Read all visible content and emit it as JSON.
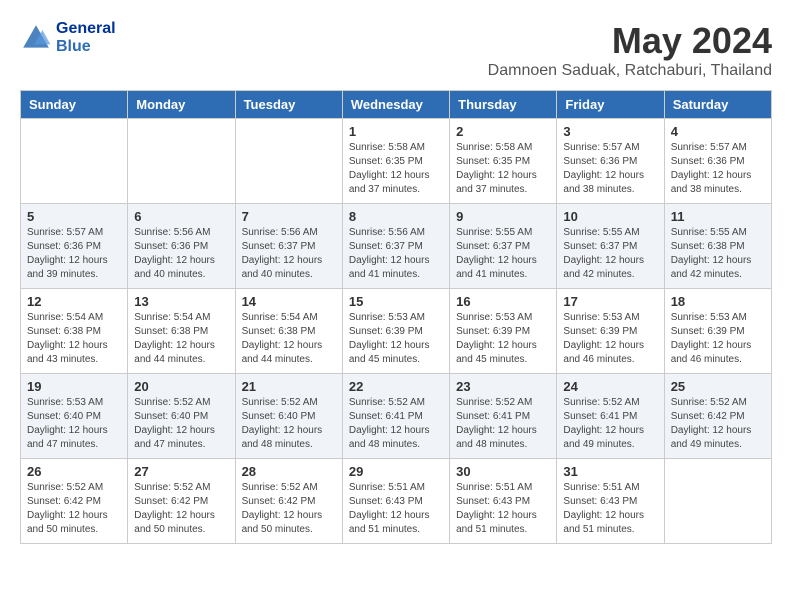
{
  "header": {
    "logo_line1": "General",
    "logo_line2": "Blue",
    "month": "May 2024",
    "location": "Damnoen Saduak, Ratchaburi, Thailand"
  },
  "days_of_week": [
    "Sunday",
    "Monday",
    "Tuesday",
    "Wednesday",
    "Thursday",
    "Friday",
    "Saturday"
  ],
  "weeks": [
    [
      {
        "day": "",
        "info": ""
      },
      {
        "day": "",
        "info": ""
      },
      {
        "day": "",
        "info": ""
      },
      {
        "day": "1",
        "info": "Sunrise: 5:58 AM\nSunset: 6:35 PM\nDaylight: 12 hours\nand 37 minutes."
      },
      {
        "day": "2",
        "info": "Sunrise: 5:58 AM\nSunset: 6:35 PM\nDaylight: 12 hours\nand 37 minutes."
      },
      {
        "day": "3",
        "info": "Sunrise: 5:57 AM\nSunset: 6:36 PM\nDaylight: 12 hours\nand 38 minutes."
      },
      {
        "day": "4",
        "info": "Sunrise: 5:57 AM\nSunset: 6:36 PM\nDaylight: 12 hours\nand 38 minutes."
      }
    ],
    [
      {
        "day": "5",
        "info": "Sunrise: 5:57 AM\nSunset: 6:36 PM\nDaylight: 12 hours\nand 39 minutes."
      },
      {
        "day": "6",
        "info": "Sunrise: 5:56 AM\nSunset: 6:36 PM\nDaylight: 12 hours\nand 40 minutes."
      },
      {
        "day": "7",
        "info": "Sunrise: 5:56 AM\nSunset: 6:37 PM\nDaylight: 12 hours\nand 40 minutes."
      },
      {
        "day": "8",
        "info": "Sunrise: 5:56 AM\nSunset: 6:37 PM\nDaylight: 12 hours\nand 41 minutes."
      },
      {
        "day": "9",
        "info": "Sunrise: 5:55 AM\nSunset: 6:37 PM\nDaylight: 12 hours\nand 41 minutes."
      },
      {
        "day": "10",
        "info": "Sunrise: 5:55 AM\nSunset: 6:37 PM\nDaylight: 12 hours\nand 42 minutes."
      },
      {
        "day": "11",
        "info": "Sunrise: 5:55 AM\nSunset: 6:38 PM\nDaylight: 12 hours\nand 42 minutes."
      }
    ],
    [
      {
        "day": "12",
        "info": "Sunrise: 5:54 AM\nSunset: 6:38 PM\nDaylight: 12 hours\nand 43 minutes."
      },
      {
        "day": "13",
        "info": "Sunrise: 5:54 AM\nSunset: 6:38 PM\nDaylight: 12 hours\nand 44 minutes."
      },
      {
        "day": "14",
        "info": "Sunrise: 5:54 AM\nSunset: 6:38 PM\nDaylight: 12 hours\nand 44 minutes."
      },
      {
        "day": "15",
        "info": "Sunrise: 5:53 AM\nSunset: 6:39 PM\nDaylight: 12 hours\nand 45 minutes."
      },
      {
        "day": "16",
        "info": "Sunrise: 5:53 AM\nSunset: 6:39 PM\nDaylight: 12 hours\nand 45 minutes."
      },
      {
        "day": "17",
        "info": "Sunrise: 5:53 AM\nSunset: 6:39 PM\nDaylight: 12 hours\nand 46 minutes."
      },
      {
        "day": "18",
        "info": "Sunrise: 5:53 AM\nSunset: 6:39 PM\nDaylight: 12 hours\nand 46 minutes."
      }
    ],
    [
      {
        "day": "19",
        "info": "Sunrise: 5:53 AM\nSunset: 6:40 PM\nDaylight: 12 hours\nand 47 minutes."
      },
      {
        "day": "20",
        "info": "Sunrise: 5:52 AM\nSunset: 6:40 PM\nDaylight: 12 hours\nand 47 minutes."
      },
      {
        "day": "21",
        "info": "Sunrise: 5:52 AM\nSunset: 6:40 PM\nDaylight: 12 hours\nand 48 minutes."
      },
      {
        "day": "22",
        "info": "Sunrise: 5:52 AM\nSunset: 6:41 PM\nDaylight: 12 hours\nand 48 minutes."
      },
      {
        "day": "23",
        "info": "Sunrise: 5:52 AM\nSunset: 6:41 PM\nDaylight: 12 hours\nand 48 minutes."
      },
      {
        "day": "24",
        "info": "Sunrise: 5:52 AM\nSunset: 6:41 PM\nDaylight: 12 hours\nand 49 minutes."
      },
      {
        "day": "25",
        "info": "Sunrise: 5:52 AM\nSunset: 6:42 PM\nDaylight: 12 hours\nand 49 minutes."
      }
    ],
    [
      {
        "day": "26",
        "info": "Sunrise: 5:52 AM\nSunset: 6:42 PM\nDaylight: 12 hours\nand 50 minutes."
      },
      {
        "day": "27",
        "info": "Sunrise: 5:52 AM\nSunset: 6:42 PM\nDaylight: 12 hours\nand 50 minutes."
      },
      {
        "day": "28",
        "info": "Sunrise: 5:52 AM\nSunset: 6:42 PM\nDaylight: 12 hours\nand 50 minutes."
      },
      {
        "day": "29",
        "info": "Sunrise: 5:51 AM\nSunset: 6:43 PM\nDaylight: 12 hours\nand 51 minutes."
      },
      {
        "day": "30",
        "info": "Sunrise: 5:51 AM\nSunset: 6:43 PM\nDaylight: 12 hours\nand 51 minutes."
      },
      {
        "day": "31",
        "info": "Sunrise: 5:51 AM\nSunset: 6:43 PM\nDaylight: 12 hours\nand 51 minutes."
      },
      {
        "day": "",
        "info": ""
      }
    ]
  ]
}
